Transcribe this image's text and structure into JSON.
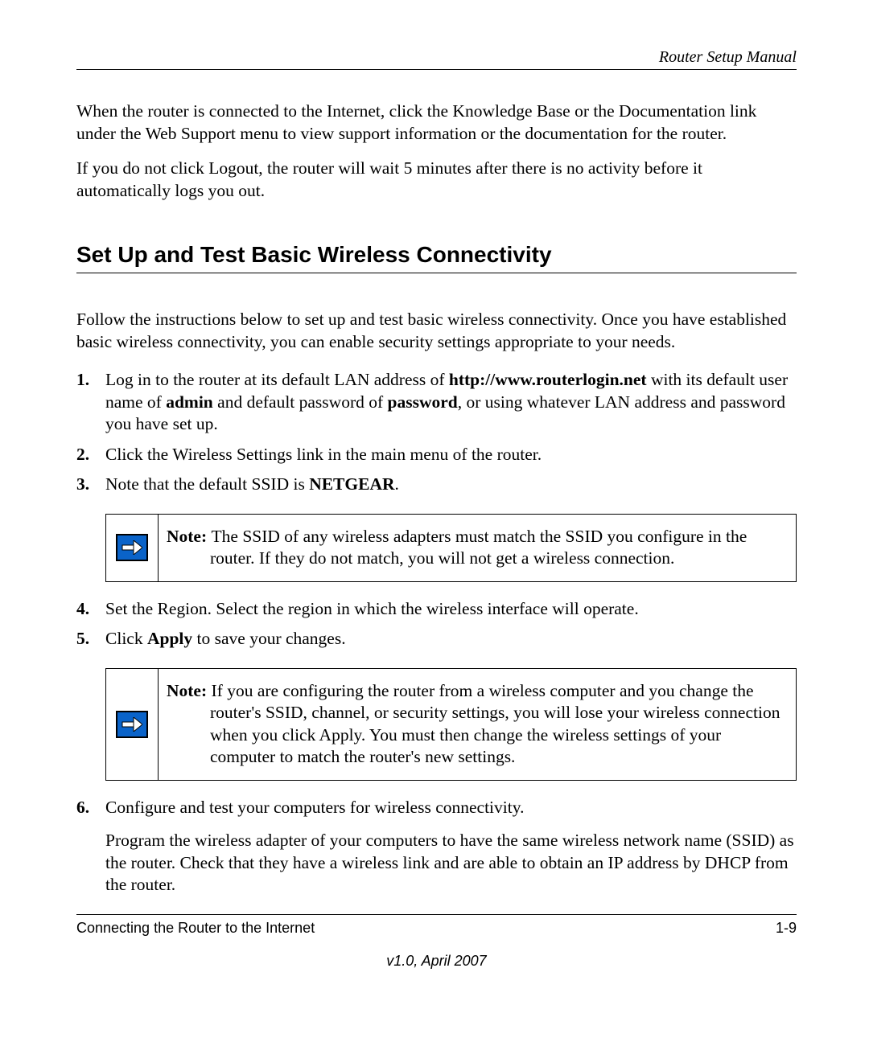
{
  "header": {
    "title": "Router Setup Manual"
  },
  "intro_paras": [
    "When the router is connected to the Internet, click the Knowledge Base or the Documentation link under the Web Support menu to view support information or the documentation for the router.",
    "If you do not click Logout, the router will wait 5 minutes after there is no activity before it automatically logs you out."
  ],
  "section": {
    "title": "Set Up and Test Basic Wireless Connectivity",
    "intro": "Follow the instructions below to set up and test basic wireless connectivity. Once you have established basic wireless connectivity, you can enable security settings appropriate to your needs."
  },
  "steps": {
    "s1": {
      "num": "1.",
      "pre": "Log in to the router at its default LAN address of ",
      "url": "http://www.routerlogin.net",
      "mid1": " with its default user name of ",
      "admin": "admin",
      "mid2": " and default password of ",
      "pwd": "password",
      "post": ", or using whatever LAN address and password you have set up."
    },
    "s2": {
      "num": "2.",
      "text": "Click the Wireless Settings link in the main menu of the router."
    },
    "s3": {
      "num": "3.",
      "pre": "Note that the default SSID is ",
      "ssid": "NETGEAR",
      "post": "."
    },
    "s4": {
      "num": "4.",
      "text": "Set the Region. Select the region in which the wireless interface will operate."
    },
    "s5": {
      "num": "5.",
      "pre": "Click ",
      "apply": "Apply",
      "post": " to save your changes."
    },
    "s6": {
      "num": "6.",
      "text": "Configure and test your computers for wireless connectivity.",
      "sub": "Program the wireless adapter of your computers to have the same wireless network name (SSID) as the router. Check that they have a wireless link and are able to obtain an IP address by DHCP from the router."
    }
  },
  "notes": {
    "n1": {
      "label": "Note: ",
      "text": "The SSID of any wireless adapters must match the SSID you configure in the router. If they do not match, you will not get a wireless connection."
    },
    "n2": {
      "label": "Note: ",
      "text": "If you are configuring the router from a wireless computer and you change the router's SSID, channel, or security settings, you will lose your wireless connection when you click Apply. You must then change the wireless settings of your computer to match the router's new settings."
    }
  },
  "footer": {
    "left": "Connecting the Router to the Internet",
    "right": "1-9",
    "version": "v1.0, April 2007"
  }
}
